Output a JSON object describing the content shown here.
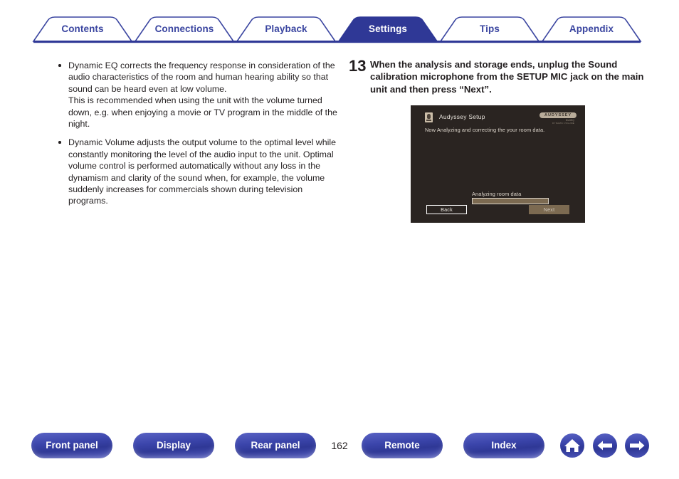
{
  "tabs": [
    {
      "label": "Contents",
      "active": false
    },
    {
      "label": "Connections",
      "active": false
    },
    {
      "label": "Playback",
      "active": false
    },
    {
      "label": "Settings",
      "active": true
    },
    {
      "label": "Tips",
      "active": false
    },
    {
      "label": "Appendix",
      "active": false
    }
  ],
  "colors": {
    "tab_accent": "#3a45a0",
    "tab_active_bg": "#2f3896",
    "pill_blue": "#2f3896",
    "osd_bg": "#2a2421",
    "osd_accent": "#7c6a51"
  },
  "left_column": {
    "bullets": [
      "Dynamic EQ corrects the frequency response in consideration of the audio characteristics of the room and human hearing ability so that sound can be heard even at low volume.\nThis is recommended when using the unit with the volume turned down, e.g. when enjoying a movie or TV program in the middle of the night.",
      "Dynamic Volume adjusts the output volume to the optimal level while constantly monitoring the level of the audio input to the unit. Optimal volume control is performed automatically without any loss in the dynamism and clarity of the sound when, for example, the volume suddenly increases for commercials shown during television programs."
    ]
  },
  "right_column": {
    "step_number": "13",
    "step_text": "When the analysis and storage ends, unplug the Sound calibration microphone from the SETUP MIC jack on the main unit and then press “Next”."
  },
  "osd": {
    "title": "Audyssey Setup",
    "subtitle": "Now Analyzing and correcting the your room data.",
    "logo_main": "AUDYSSEY",
    "logo_sub1": "MultEQ",
    "logo_sub2": "DYNAMIC VOLUME",
    "progress_label": "Analyzing room data",
    "progress_percent": 100,
    "back_label": "Back",
    "next_label": "Next"
  },
  "footer": {
    "buttons": [
      {
        "label": "Front panel"
      },
      {
        "label": "Display"
      },
      {
        "label": "Rear panel"
      },
      {
        "label": "Remote"
      },
      {
        "label": "Index"
      }
    ],
    "page_number": "162",
    "icons": [
      {
        "name": "home-icon"
      },
      {
        "name": "arrow-left-icon"
      },
      {
        "name": "arrow-right-icon"
      }
    ]
  }
}
